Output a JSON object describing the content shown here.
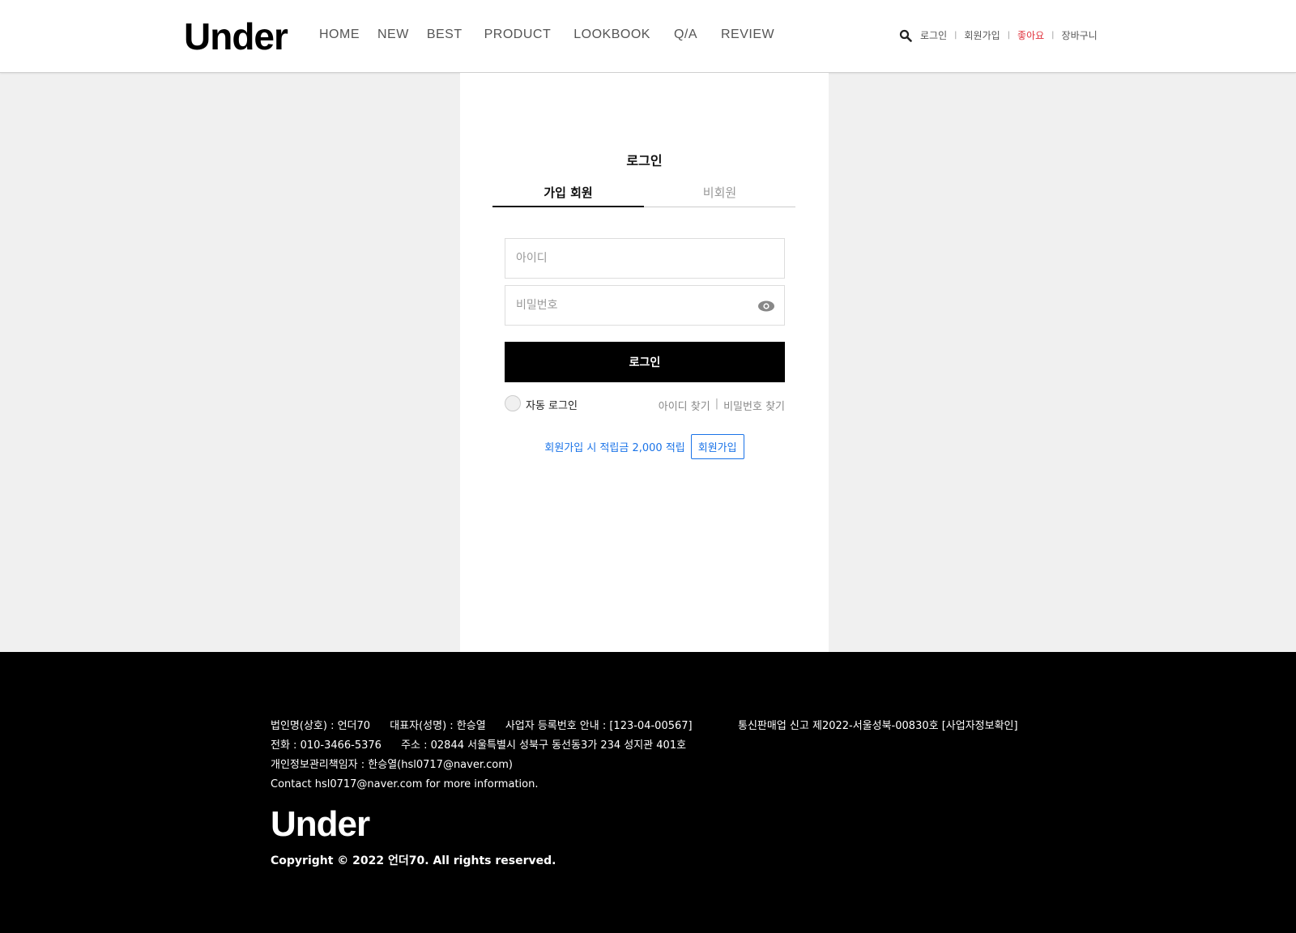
{
  "header": {
    "logo": "Under",
    "nav": [
      "HOME",
      "NEW",
      "BEST",
      "PRODUCT",
      "LOOKBOOK",
      "Q/A",
      "REVIEW"
    ],
    "util": {
      "login": "로그인",
      "signup": "회원가입",
      "like": "좋아요",
      "cart": "장바구니",
      "separator": "|"
    }
  },
  "login": {
    "title": "로그인",
    "tabs": [
      "가입 회원",
      "비회원"
    ],
    "id_placeholder": "아이디",
    "password_placeholder": "비밀번호",
    "submit": "로그인",
    "auto_login": "자동 로그인",
    "find_id": "아이디 찾기",
    "find_pw": "비밀번호 찾기",
    "separator": "|",
    "promo_text": "회원가입 시 적립금 2,000 적립",
    "promo_button": "회원가입"
  },
  "footer": {
    "company": "법인명(상호) : 언더70",
    "ceo": "대표자(성명) : 한승열",
    "business_no": "사업자 등록번호 안내 : [123-04-00567]",
    "mail_order": "통신판매업 신고 제2022-서울성북-00830호 [사업자정보확인]",
    "phone": "전화 : 010-3466-5376",
    "address": "주소 : 02844 서울특별시 성북구 동선동3가 234 성지관 401호",
    "privacy": "개인정보관리책임자 : 한승열(hsl0717@naver.com)",
    "contact": "Contact hsl0717@naver.com for more information.",
    "logo": "Under",
    "copyright": "Copyright © 2022 언더70. All rights reserved."
  },
  "colors": {
    "accent_blue": "#1a73e8",
    "like_red": "#e0323c",
    "button_black": "#000000"
  }
}
